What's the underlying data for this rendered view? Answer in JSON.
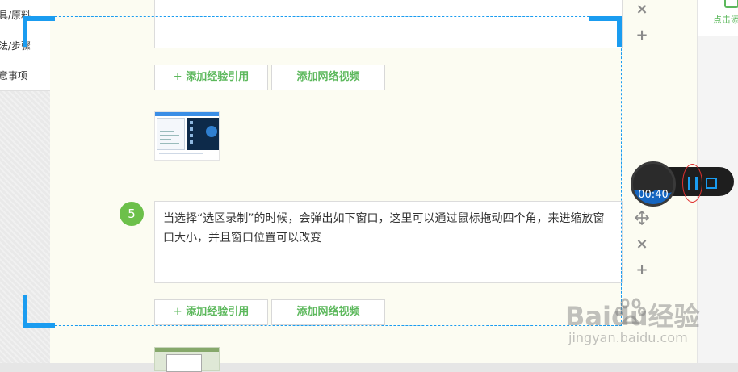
{
  "sidebar": {
    "items": [
      {
        "label": "具/原料"
      },
      {
        "label": "法/步骤"
      },
      {
        "label": "意事项"
      }
    ]
  },
  "right_panel": {
    "add_label": "点击添"
  },
  "steps": [
    {
      "buttons": {
        "add_experience": "+ 添加经验引用",
        "add_video": "添加网络视频"
      }
    },
    {
      "number": "5",
      "text": "当选择“选区录制”的时候，会弹出如下窗口，这里可以通过鼠标拖动四个角，来进缩放窗口大小，并且窗口位置可以改变",
      "buttons": {
        "add_experience": "+ 添加经验引用",
        "add_video": "添加网络视频"
      }
    }
  ],
  "controls": {
    "close_symbol": "×",
    "add_symbol": "+"
  },
  "recorder": {
    "timer": "00:40",
    "accent_color": "#1a9cf0"
  },
  "watermark": {
    "brand": "Baidu经验",
    "url": "jingyan.baidu.com"
  },
  "colors": {
    "accent_green": "#5cb85c",
    "step_badge": "#6cc04a",
    "selection": "#1a9cf0",
    "highlight_ellipse": "#e03030"
  }
}
